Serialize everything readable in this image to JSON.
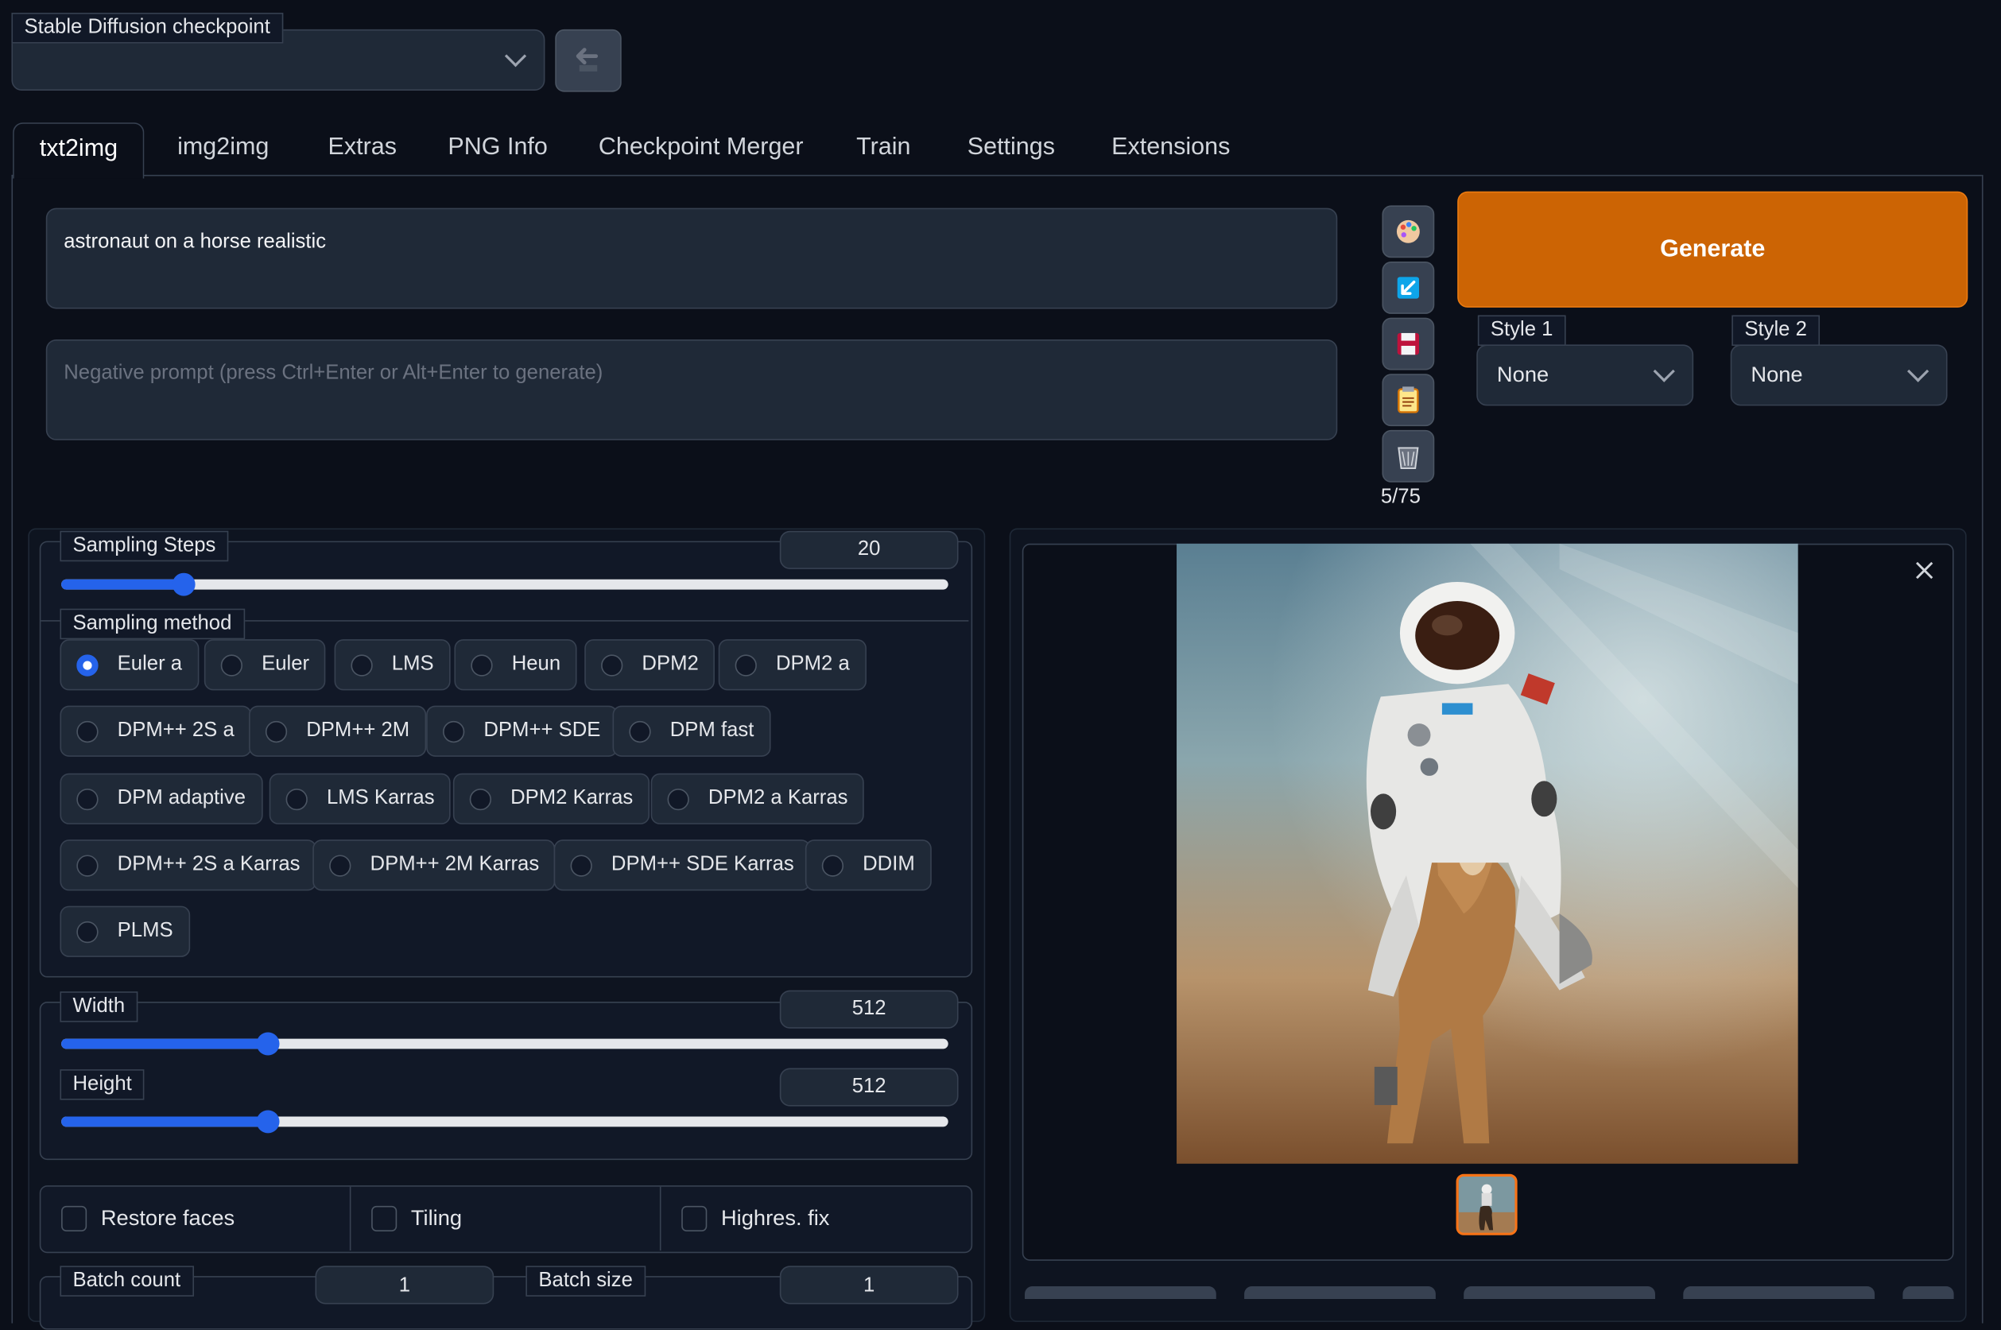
{
  "checkpoint": {
    "label": "Stable Diffusion checkpoint",
    "value": ""
  },
  "tabs": [
    "txt2img",
    "img2img",
    "Extras",
    "PNG Info",
    "Checkpoint Merger",
    "Train",
    "Settings",
    "Extensions"
  ],
  "active_tab": "txt2img",
  "prompt": {
    "value": "astronaut on a horse realistic"
  },
  "negative_prompt": {
    "value": "",
    "placeholder": "Negative prompt (press Ctrl+Enter or Alt+Enter to generate)"
  },
  "tools": {
    "token_count": "5/75",
    "icons": [
      "palette-icon",
      "arrow-icon",
      "save-icon",
      "clipboard-icon",
      "trash-icon"
    ]
  },
  "generate": {
    "label": "Generate",
    "color": "#cc6404"
  },
  "styles": [
    {
      "label": "Style 1",
      "value": "None"
    },
    {
      "label": "Style 2",
      "value": "None"
    }
  ],
  "sampling_steps": {
    "label": "Sampling Steps",
    "value": "20",
    "fraction": 0.138
  },
  "sampling_method": {
    "label": "Sampling method",
    "selected": "Euler a",
    "options": [
      "Euler a",
      "Euler",
      "LMS",
      "Heun",
      "DPM2",
      "DPM2 a",
      "DPM++ 2S a",
      "DPM++ 2M",
      "DPM++ SDE",
      "DPM fast",
      "DPM adaptive",
      "LMS Karras",
      "DPM2 Karras",
      "DPM2 a Karras",
      "DPM++ 2S a Karras",
      "DPM++ 2M Karras",
      "DPM++ SDE Karras",
      "DDIM",
      "PLMS"
    ]
  },
  "width": {
    "label": "Width",
    "value": "512",
    "fraction": 0.233
  },
  "height": {
    "label": "Height",
    "value": "512",
    "fraction": 0.233
  },
  "options": [
    {
      "label": "Restore faces",
      "checked": false
    },
    {
      "label": "Tiling",
      "checked": false
    },
    {
      "label": "Highres. fix",
      "checked": false
    }
  ],
  "batch_count": {
    "label": "Batch count",
    "value": "1"
  },
  "batch_size": {
    "label": "Batch size",
    "value": "1"
  },
  "colors": {
    "accent": "#2563eb",
    "background": "#0b0f19",
    "panel": "#1f2937",
    "generate": "#cc6404"
  }
}
